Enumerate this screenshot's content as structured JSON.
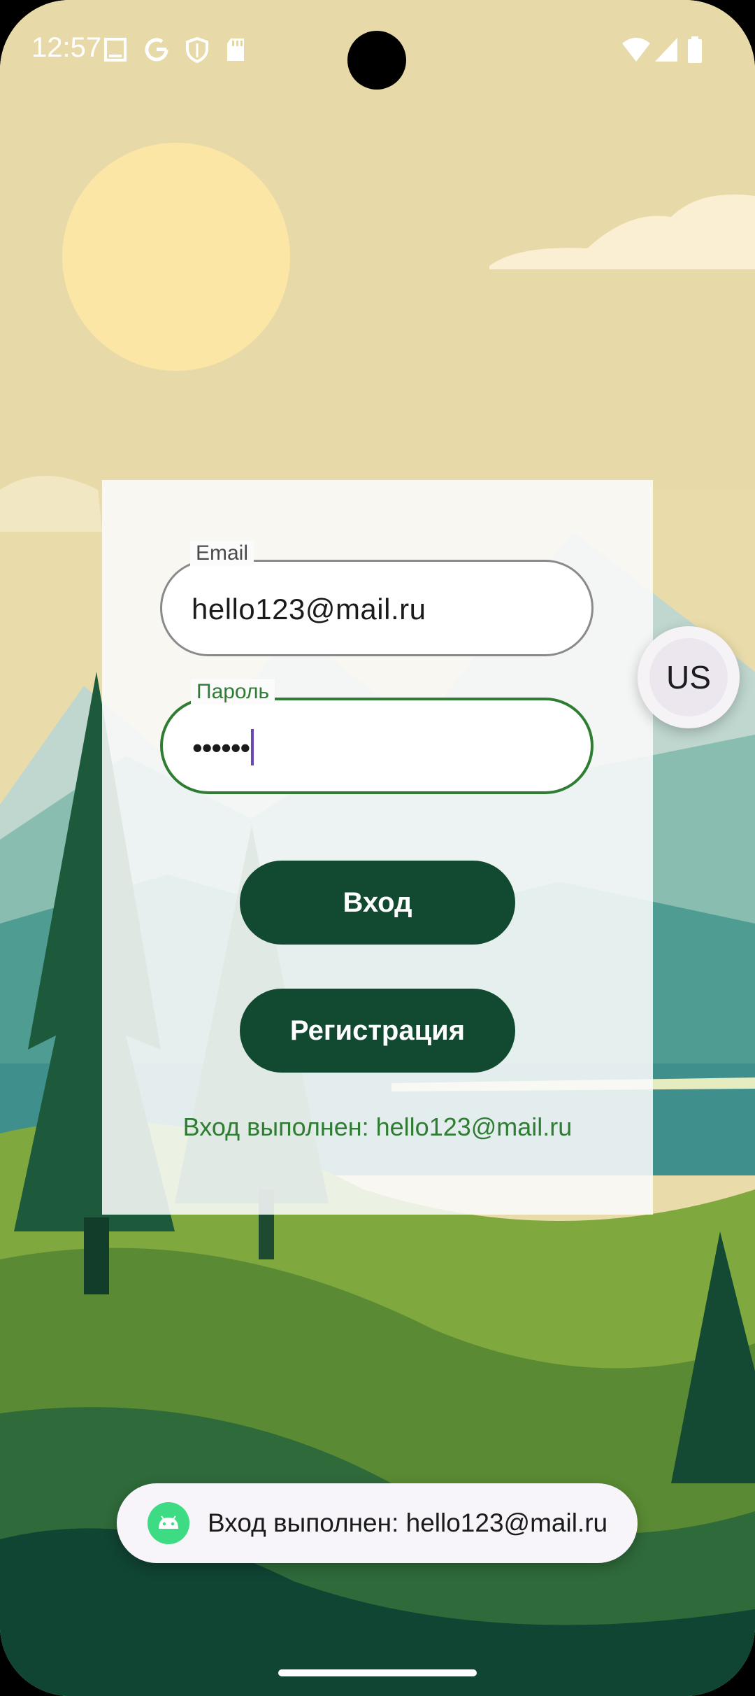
{
  "status_bar": {
    "time": "12:57",
    "left_icons": [
      "screen-icon",
      "google-icon",
      "shield-icon",
      "sd-card-icon"
    ],
    "right_icons": [
      "wifi-icon",
      "signal-icon",
      "battery-icon"
    ]
  },
  "form": {
    "email": {
      "label": "Email",
      "value": "hello123@mail.ru"
    },
    "password": {
      "label": "Пароль",
      "value": "••••••"
    },
    "login_button": "Вход",
    "register_button": "Регистрация",
    "status_message": "Вход выполнен: hello123@mail.ru"
  },
  "language_button": {
    "label": "US"
  },
  "toast": {
    "icon": "android-icon",
    "text": "Вход выполнен: hello123@mail.ru"
  },
  "colors": {
    "primary_button": "#114a30",
    "accent_green": "#2e7d32",
    "caret": "#6a4bb5"
  }
}
